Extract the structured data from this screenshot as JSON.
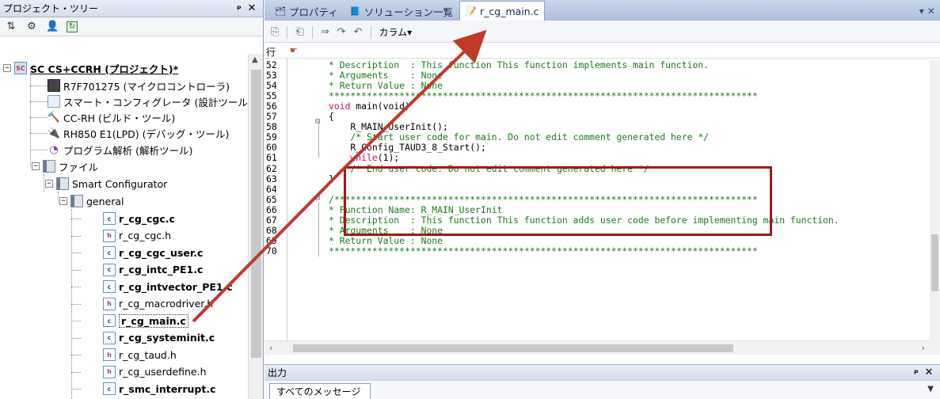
{
  "tree_panel": {
    "title": "プロジェクト・ツリー",
    "pin_symbol": "ᵖ",
    "close_symbol": "✕"
  },
  "tree": {
    "project": "SC CS+CCRH (プロジェクト)*",
    "microcontroller": "R7F701275 (マイクロコントローラ)",
    "smart_configurator_tool": "スマート・コンフィグレータ (設計ツール)",
    "build_tool": "CC-RH (ビルド・ツール)",
    "debug_tool": "RH850 E1(LPD) (デバッグ・ツール)",
    "analysis_tool": "プログラム解析 (解析ツール)",
    "files_folder": "ファイル",
    "smart_configurator_folder": "Smart Configurator",
    "general_folder": "general",
    "files": [
      {
        "name": "r_cg_cgc.c",
        "kind": "c",
        "bold": true
      },
      {
        "name": "r_cg_cgc.h",
        "kind": "h",
        "bold": false
      },
      {
        "name": "r_cg_cgc_user.c",
        "kind": "c",
        "bold": true
      },
      {
        "name": "r_cg_intc_PE1.c",
        "kind": "c",
        "bold": true
      },
      {
        "name": "r_cg_intvector_PE1.c",
        "kind": "c",
        "bold": true
      },
      {
        "name": "r_cg_macrodriver.h",
        "kind": "h",
        "bold": false
      },
      {
        "name": "r_cg_main.c",
        "kind": "c",
        "bold": true
      },
      {
        "name": "r_cg_systeminit.c",
        "kind": "c",
        "bold": true
      },
      {
        "name": "r_cg_taud.h",
        "kind": "h",
        "bold": false
      },
      {
        "name": "r_cg_userdefine.h",
        "kind": "h",
        "bold": false
      },
      {
        "name": "r_smc_interrupt.c",
        "kind": "c",
        "bold": true
      }
    ]
  },
  "editor_tabs": [
    {
      "label": "プロパティ",
      "active": false
    },
    {
      "label": "ソリューション一覧",
      "active": false
    },
    {
      "label": "r_cg_main.c",
      "active": true
    }
  ],
  "editor_toolbar": {
    "column_menu": "カラム"
  },
  "gutter_header": {
    "line_label": "行"
  },
  "code": [
    {
      "line": "52",
      "text": "* Description  : This function This function implements main function.",
      "kind": "cmt"
    },
    {
      "line": "53",
      "text": "* Arguments    : None",
      "kind": "cmt"
    },
    {
      "line": "54",
      "text": "* Return Value : None",
      "kind": "cmt"
    },
    {
      "line": "55",
      "text": "*******************************************************************************",
      "kind": "cmt"
    },
    {
      "line": "56",
      "text": "void main(void)",
      "kind": "void"
    },
    {
      "line": "57",
      "text": "{",
      "kind": "plain"
    },
    {
      "line": "58",
      "text": "    R_MAIN_UserInit();",
      "kind": "plain"
    },
    {
      "line": "59",
      "text": "    /* Start user code for main. Do not edit comment generated here */",
      "kind": "cmt"
    },
    {
      "line": "60",
      "text": "    R_Config_TAUD3_8_Start();",
      "kind": "plain"
    },
    {
      "line": "61",
      "text": "    while(1);",
      "kind": "while"
    },
    {
      "line": "62",
      "text": "    /* End user code. Do not edit comment generated here */",
      "kind": "cmt"
    },
    {
      "line": "63",
      "text": "}",
      "kind": "plain"
    },
    {
      "line": "64",
      "text": "",
      "kind": "plain"
    },
    {
      "line": "65",
      "text": "/******************************************************************************",
      "kind": "cmt"
    },
    {
      "line": "66",
      "text": "* Function Name: R_MAIN_UserInit",
      "kind": "cmt"
    },
    {
      "line": "67",
      "text": "* Description  : This function This function adds user code before implementing main function.",
      "kind": "cmt"
    },
    {
      "line": "68",
      "text": "* Arguments    : None",
      "kind": "cmt"
    },
    {
      "line": "69",
      "text": "* Return Value : None",
      "kind": "cmt"
    },
    {
      "line": "70",
      "text": "*******************************************************************************",
      "kind": "cmt"
    }
  ],
  "output_panel": {
    "title": "出力",
    "tab": "すべてのメッセージ"
  },
  "colors": {
    "comment": "#1f7a1f",
    "keyword": "#c0146e",
    "highlight_box": "#a01818",
    "annotation_arrow": "#c0392b"
  }
}
